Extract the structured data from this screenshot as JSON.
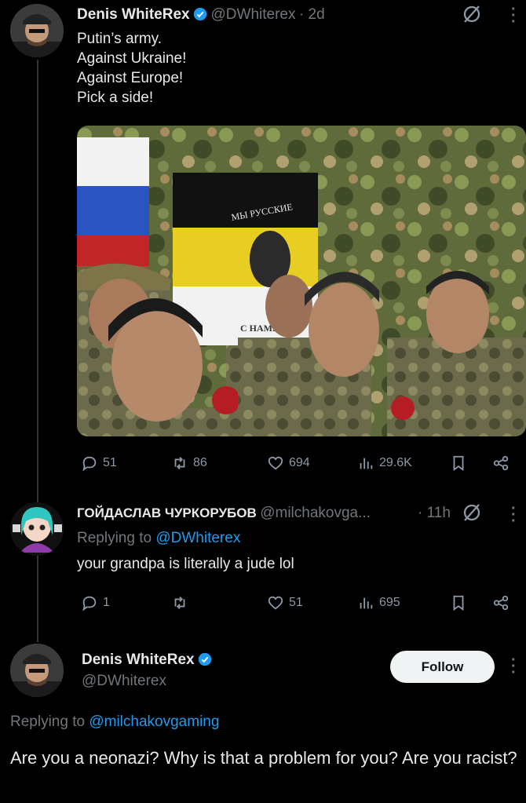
{
  "tweet1": {
    "name": "Denis WhiteRex",
    "handle": "@DWhiterex",
    "time": "· 2d",
    "lines": [
      "Putin’s army.",
      "Against Ukraine!",
      "Against Europe!",
      "Pick a side!"
    ],
    "flag_text_top": "МЫ РУССКИЕ",
    "flag_text_bottom": "С НАМИ",
    "actions": {
      "replies": "51",
      "reposts": "86",
      "likes": "694",
      "views": "29.6K"
    }
  },
  "reply": {
    "name": "ГОЙДАСЛАВ ЧУРКОРУБОВ",
    "handle": "@milchakovga...",
    "time": "· 11h",
    "replying_label": "Replying to",
    "replying_to": "@DWhiterex",
    "text": "your grandpa is literally a jude lol",
    "actions": {
      "replies": "1",
      "reposts": "",
      "likes": "51",
      "views": "695"
    }
  },
  "main": {
    "name": "Denis WhiteRex",
    "handle": "@DWhiterex",
    "follow_label": "Follow",
    "replying_label": "Replying to",
    "replying_to": "@milchakovgaming",
    "text": "Are you a neonazi? Why is that a problem for you? Are you racist?"
  },
  "colors": {
    "background": "#000000",
    "accent": "#1d9bf0",
    "muted": "#71767b",
    "verified": "#1d9bf0"
  },
  "icons": [
    "reply-icon",
    "repost-icon",
    "like-icon",
    "views-icon",
    "bookmark-icon",
    "share-icon",
    "grok-icon",
    "more-icon",
    "verified-icon"
  ]
}
